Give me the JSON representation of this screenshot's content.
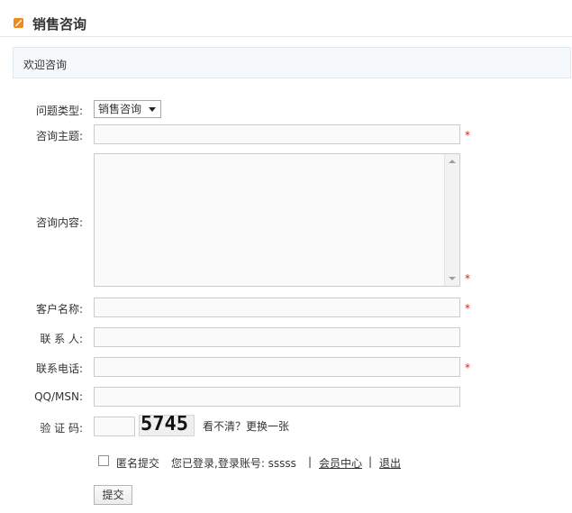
{
  "header": {
    "title": "销售咨询"
  },
  "welcome": "欢迎咨询",
  "form": {
    "type_label": "问题类型:",
    "type_selected": "销售咨询",
    "subject_label": "咨询主题:",
    "content_label": "咨询内容:",
    "customer_label": "客户名称:",
    "contact_label": "联 系 人:",
    "phone_label": "联系电话:",
    "qqmsn_label": "QQ/MSN:",
    "captcha_label": "验 证 码:",
    "required_mark": "*"
  },
  "captcha": {
    "code": "5745",
    "refresh_text": "看不清？更换一张"
  },
  "footer": {
    "anonymous_label": "匿名提交",
    "logged_in_text": "您已登录,登录账号: sssss",
    "separator": "|",
    "member_center": "会员中心",
    "logout": "退出",
    "submit": "提交"
  }
}
